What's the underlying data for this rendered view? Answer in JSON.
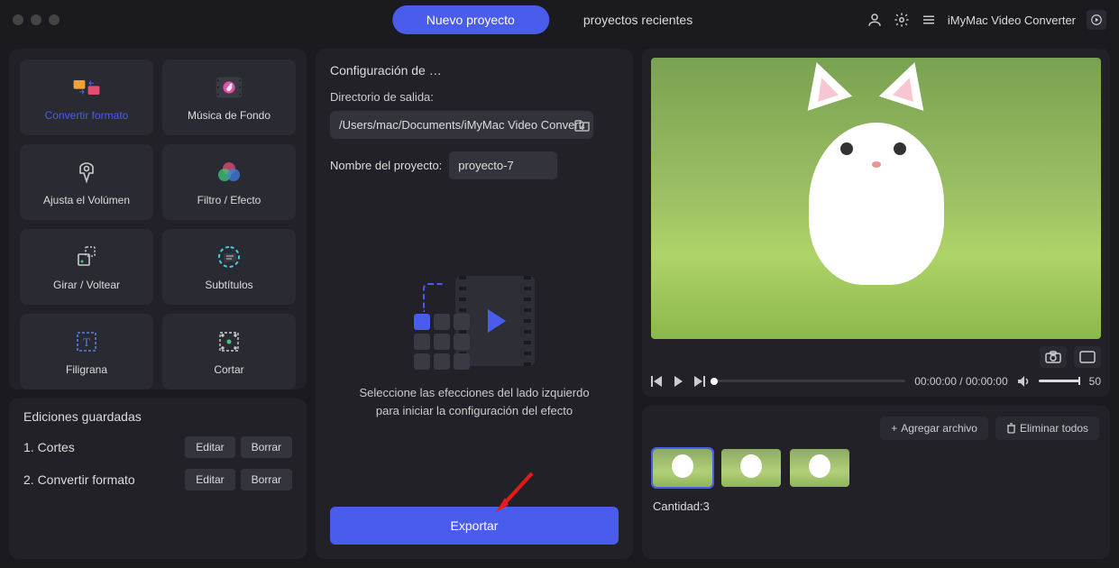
{
  "titlebar": {
    "tabs": {
      "new_project": "Nuevo proyecto",
      "recent_projects": "proyectos recientes"
    },
    "app_name": "iMyMac Video Converter"
  },
  "tools": [
    {
      "label": "Convertir formato",
      "active": true
    },
    {
      "label": "Música de Fondo",
      "active": false
    },
    {
      "label": "Ajusta el Volúmen",
      "active": false
    },
    {
      "label": "Filtro / Efecto",
      "active": false
    },
    {
      "label": "Girar / Voltear",
      "active": false
    },
    {
      "label": "Subtítulos",
      "active": false
    },
    {
      "label": "Filigrana",
      "active": false
    },
    {
      "label": "Cortar",
      "active": false
    }
  ],
  "saved": {
    "title": "Ediciones guardadas",
    "rows": [
      {
        "label": "1.  Cortes"
      },
      {
        "label": "2.  Convertir formato"
      }
    ],
    "edit_label": "Editar",
    "delete_label": "Borrar"
  },
  "mid": {
    "title": "Configuración de …",
    "output_dir_label": "Directorio de salida:",
    "output_dir_value": "/Users/mac/Documents/iMyMac Video Converter",
    "project_name_label": "Nombre del proyecto:",
    "project_name_value": "proyecto-7",
    "hint_line1": "Seleccione las efecciones del lado izquierdo",
    "hint_line2": "para iniciar la configuración del efecto",
    "export_label": "Exportar"
  },
  "playback": {
    "current": "00:00:00",
    "total": "00:00:00",
    "volume": 50
  },
  "bottom": {
    "add_file": "Agregar archivo",
    "remove_all": "Eliminar todos",
    "count_label": "Cantidad:",
    "count_value": 3
  }
}
